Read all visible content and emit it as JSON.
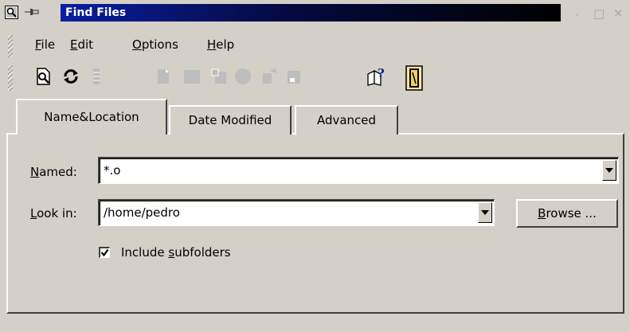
{
  "window": {
    "title": "Find Files"
  },
  "menu": [
    {
      "label": "File",
      "mnemonic": "F",
      "rest": "ile"
    },
    {
      "label": "Edit",
      "mnemonic": "E",
      "rest": "dit"
    },
    {
      "label": "Options",
      "mnemonic": "O",
      "rest": "ptions"
    },
    {
      "label": "Help",
      "mnemonic": "H",
      "rest": "elp"
    }
  ],
  "toolbar": [
    {
      "icon": "find-icon",
      "enabled": true
    },
    {
      "icon": "reset-icon",
      "enabled": true
    },
    {
      "icon": "stop-icon",
      "enabled": false
    },
    {
      "icon": "open-icon",
      "enabled": false
    },
    {
      "icon": "open-folder-icon",
      "enabled": false
    },
    {
      "icon": "delete-icon",
      "enabled": false
    },
    {
      "icon": "properties-icon",
      "enabled": false
    },
    {
      "icon": "open-with-icon",
      "enabled": false
    },
    {
      "icon": "save-icon",
      "enabled": false
    },
    {
      "icon": "help-icon",
      "enabled": true
    },
    {
      "icon": "quit-icon",
      "enabled": true
    }
  ],
  "tabs": [
    {
      "label": "Name&Location",
      "active": true
    },
    {
      "label": "Date Modified",
      "active": false
    },
    {
      "label": "Advanced",
      "active": false
    }
  ],
  "form": {
    "named_label": {
      "mnemonic": "N",
      "rest": "amed:"
    },
    "named_value": "*.o",
    "lookin_label": {
      "mnemonic": "L",
      "rest": "ook in:"
    },
    "lookin_value": "/home/pedro",
    "browse_label": {
      "mnemonic": "B",
      "rest": "rowse ..."
    },
    "include_label": {
      "pre": "Include ",
      "mnemonic": "s",
      "rest": "ubfolders"
    },
    "include_checked": true
  }
}
